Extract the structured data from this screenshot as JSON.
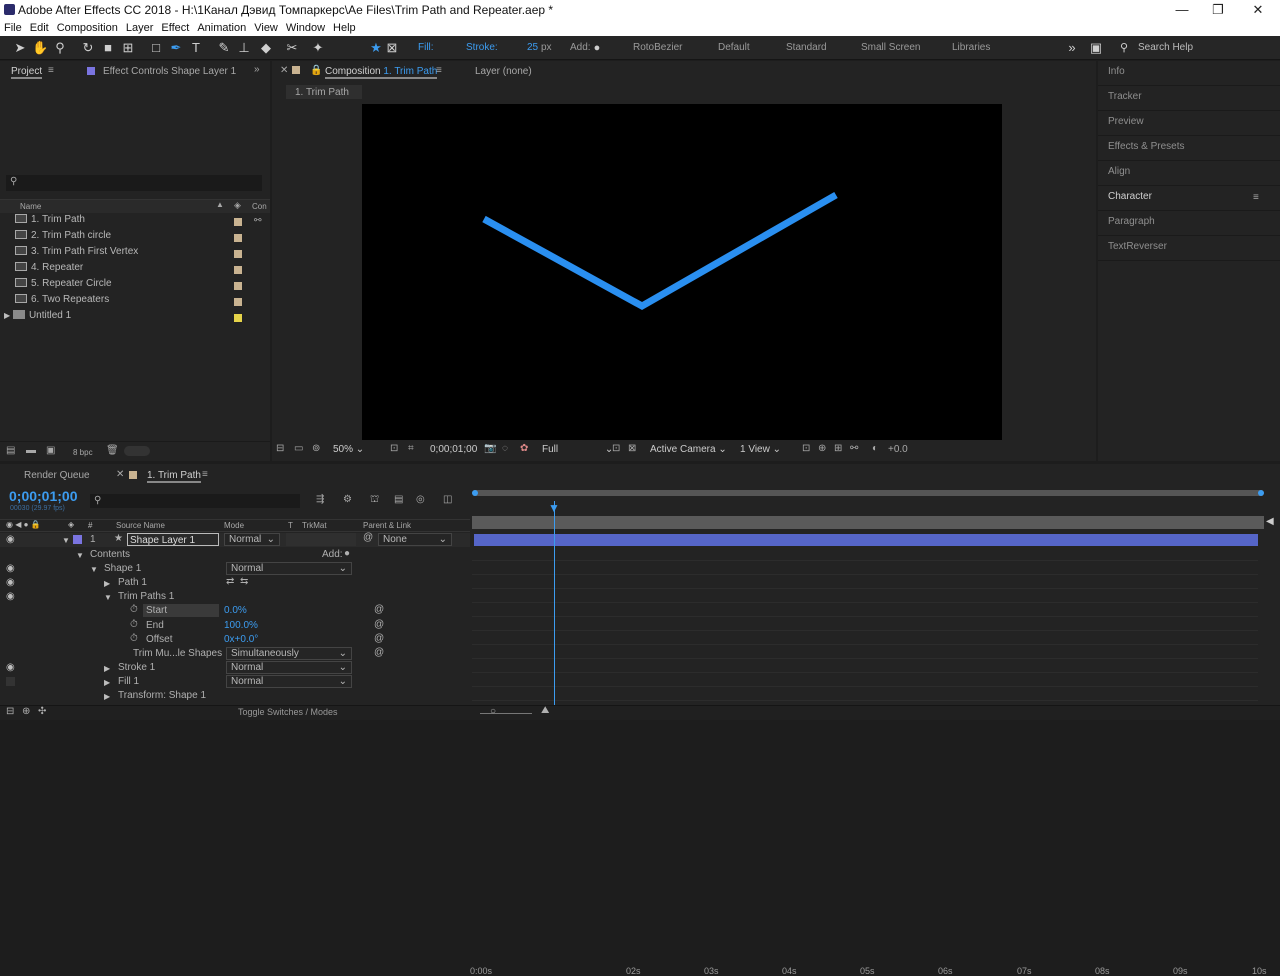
{
  "window": {
    "title": "Adobe After Effects CC 2018 - H:\\1Канал Дэвид Томпаркерс\\Ae Files\\Trim Path and Repeater.aep *",
    "minimize": "—",
    "maximize": "❐",
    "close": "✕"
  },
  "menu": [
    "File",
    "Edit",
    "Composition",
    "Layer",
    "Effect",
    "Animation",
    "View",
    "Window",
    "Help"
  ],
  "toolbar": {
    "fill_label": "Fill:",
    "stroke_label": "Stroke:",
    "stroke_width": "25",
    "stroke_unit": "px",
    "add_label": "Add:",
    "rotobezier": "RotoBezier",
    "workspaces": [
      "Default",
      "Standard",
      "Small Screen",
      "Libraries"
    ],
    "search_help": "Search Help"
  },
  "project": {
    "tab": "Project",
    "effect_controls_tab": "Effect Controls Shape Layer 1",
    "col_name": "Name",
    "col_comment": "Con",
    "items": [
      {
        "name": "1. Trim Path",
        "type": "comp"
      },
      {
        "name": "2. Trim Path circle",
        "type": "comp"
      },
      {
        "name": "3. Trim Path First Vertex",
        "type": "comp"
      },
      {
        "name": "4. Repeater",
        "type": "comp"
      },
      {
        "name": "5. Repeater Circle",
        "type": "comp"
      },
      {
        "name": "6. Two Repeaters",
        "type": "comp"
      },
      {
        "name": "Untitled 1",
        "type": "folder"
      }
    ],
    "bpc": "8 bpc"
  },
  "comp": {
    "tab": "Composition",
    "tab_name": "1. Trim Path",
    "layer_tab": "Layer  (none)",
    "breadcrumb": "1. Trim Path",
    "zoom": "50%",
    "timecode": "0;00;01;00",
    "resolution": "Full",
    "camera": "Active Camera",
    "views": "1 View",
    "exposure": "+0.0",
    "stroke_color": "#2a8ff0"
  },
  "right_panels": [
    "Info",
    "Tracker",
    "Preview",
    "Effects & Presets",
    "Align",
    "Character",
    "Paragraph",
    "TextReverser"
  ],
  "timeline": {
    "render_queue": "Render Queue",
    "tab": "1. Trim Path",
    "timecode": "0;00;01;00",
    "frames": "00030 (29.97 fps)",
    "col_source": "Source Name",
    "col_mode": "Mode",
    "col_t": "T",
    "col_trkmat": "TrkMat",
    "col_parent": "Parent & Link",
    "layer": {
      "num": "1",
      "name": "Shape Layer 1",
      "mode": "Normal",
      "parent": "None"
    },
    "contents": "Contents",
    "add": "Add:",
    "shape1": "Shape 1",
    "shape1_mode": "Normal",
    "path1": "Path 1",
    "trim": "Trim Paths 1",
    "start": "Start",
    "start_val": "0.0%",
    "end": "End",
    "end_val": "100.0%",
    "offset": "Offset",
    "offset_val": "0x+0.0°",
    "trim_multi": "Trim Mu...le Shapes",
    "trim_multi_val": "Simultaneously",
    "stroke1": "Stroke 1",
    "stroke1_mode": "Normal",
    "fill1": "Fill 1",
    "fill1_mode": "Normal",
    "transform": "Transform: Shape 1",
    "toggle": "Toggle Switches / Modes",
    "ruler": [
      "0:00s",
      "02s",
      "03s",
      "04s",
      "05s",
      "06s",
      "07s",
      "08s",
      "09s",
      "10s"
    ]
  }
}
